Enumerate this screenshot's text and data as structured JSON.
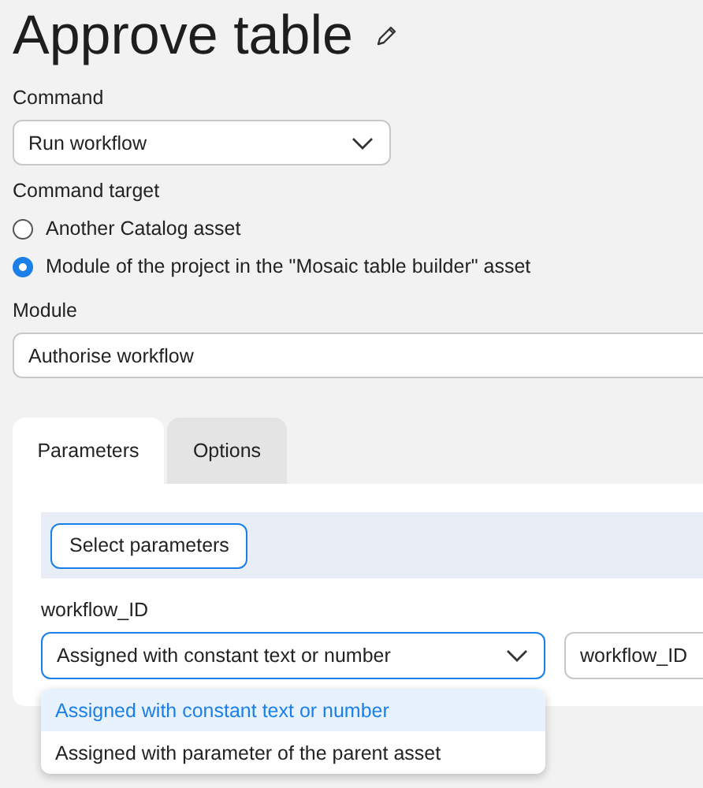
{
  "title": "Approve table",
  "command": {
    "label": "Command",
    "value": "Run workflow"
  },
  "command_target": {
    "label": "Command target",
    "options": [
      {
        "label": "Another Catalog asset",
        "selected": false
      },
      {
        "label": "Module of the project in the \"Mosaic table builder\" asset",
        "selected": true
      }
    ]
  },
  "module": {
    "label": "Module",
    "value": "Authorise workflow"
  },
  "tabs": [
    {
      "label": "Parameters",
      "selected": true
    },
    {
      "label": "Options",
      "selected": false
    }
  ],
  "parameters": {
    "button": "Select parameters",
    "items": [
      {
        "name": "workflow_ID",
        "mode": "Assigned with constant text or number",
        "value": "workflow_ID",
        "expanded": true,
        "menu": [
          {
            "label": "Assigned with constant text or number",
            "selected": true
          },
          {
            "label": "Assigned with parameter of the parent asset",
            "selected": false
          }
        ]
      }
    ]
  }
}
